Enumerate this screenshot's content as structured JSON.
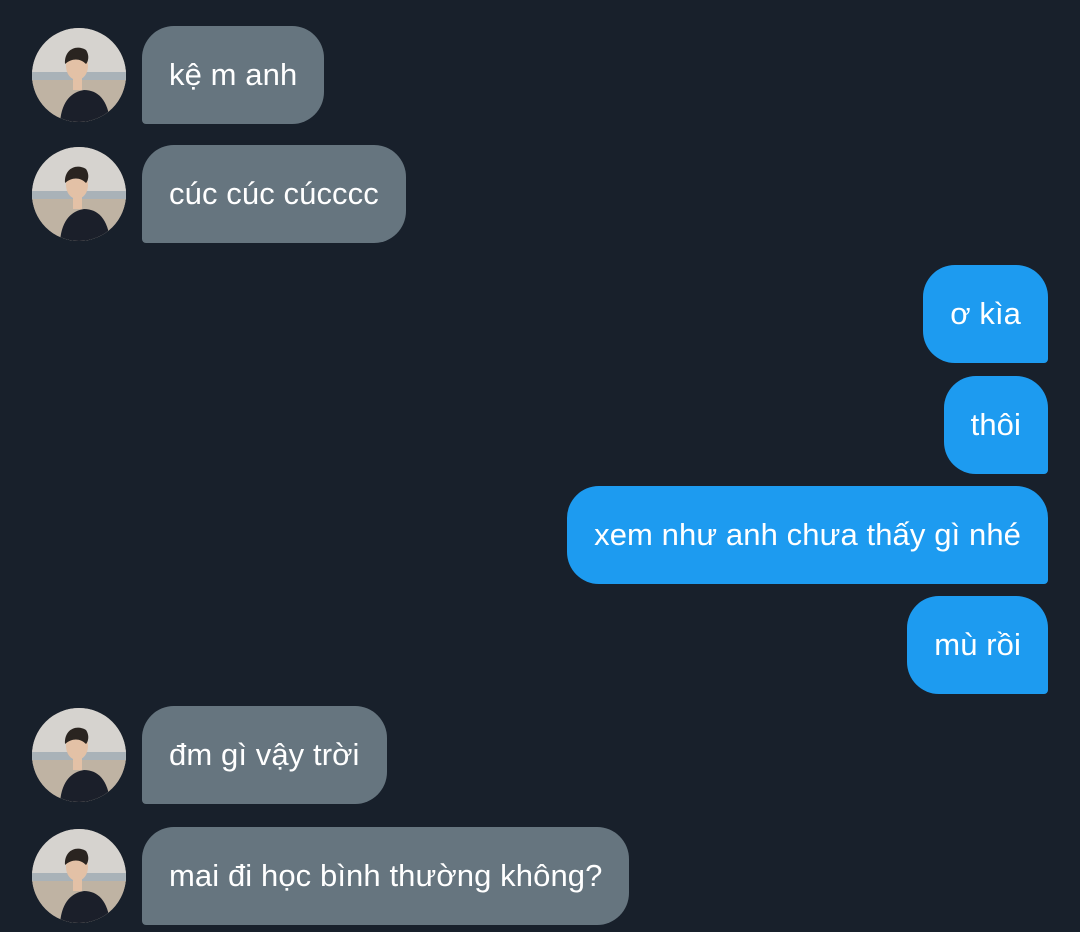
{
  "messages": [
    {
      "direction": "incoming",
      "text": "kệ m anh"
    },
    {
      "direction": "incoming",
      "text": "cúc cúc cúcccc"
    },
    {
      "direction": "outgoing",
      "text": "ơ kìa"
    },
    {
      "direction": "outgoing",
      "text": "thôi"
    },
    {
      "direction": "outgoing",
      "text": "xem như anh chưa thấy gì nhé"
    },
    {
      "direction": "outgoing",
      "text": "mù rồi"
    },
    {
      "direction": "incoming",
      "text": "đm gì vậy trời"
    },
    {
      "direction": "incoming",
      "text": "mai đi học bình thường không?"
    }
  ],
  "colors": {
    "background": "#18202b",
    "incoming_bubble": "#66757f",
    "outgoing_bubble": "#1d9bf0",
    "text": "#ffffff"
  },
  "avatar": {
    "icon": "profile-photo"
  }
}
